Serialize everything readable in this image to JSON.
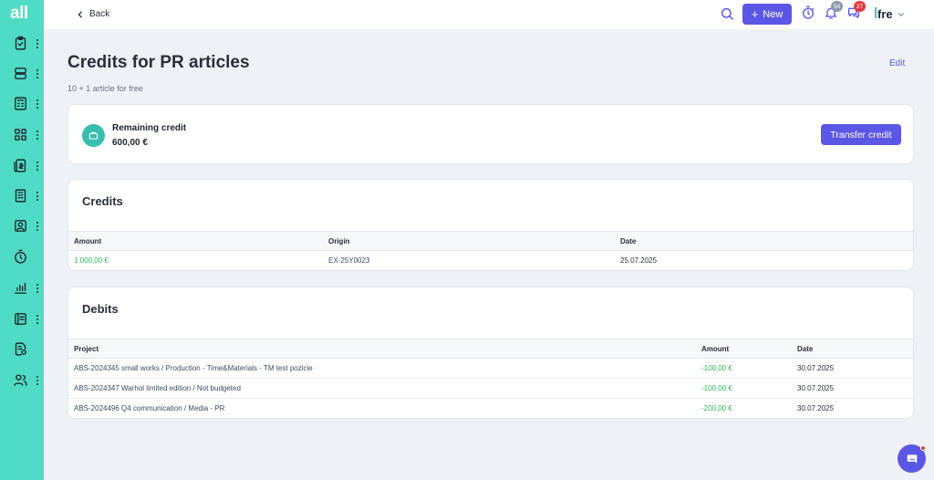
{
  "sidebar": {
    "logo": "all",
    "items": [
      {
        "icon": "clipboard-check-icon"
      },
      {
        "icon": "stack-icon"
      },
      {
        "icon": "calculator-icon"
      },
      {
        "icon": "grid-icon"
      },
      {
        "icon": "invoice-icon"
      },
      {
        "icon": "building-icon"
      },
      {
        "icon": "contact-icon"
      },
      {
        "icon": "stopwatch-icon"
      },
      {
        "icon": "bar-chart-icon"
      },
      {
        "icon": "book-icon"
      },
      {
        "icon": "document-settings-icon"
      },
      {
        "icon": "users-icon"
      }
    ]
  },
  "topbar": {
    "back_label": "Back",
    "new_label": "New",
    "notifications_count": "54",
    "messages_count": "27",
    "brand": "fre"
  },
  "page": {
    "title": "Credits for PR articles",
    "subtitle": "10 + 1 article for free",
    "edit_label": "Edit"
  },
  "remaining": {
    "label": "Remaining credit",
    "value": "600,00 €",
    "transfer_label": "Transfer credit"
  },
  "credits": {
    "title": "Credits",
    "headers": [
      "Amount",
      "Origin",
      "Date"
    ],
    "rows": [
      {
        "amount": "1 000,00 €",
        "origin": "EX-25Y0023",
        "date": "25.07.2025"
      }
    ]
  },
  "debits": {
    "title": "Debits",
    "headers": [
      "Project",
      "Amount",
      "Date"
    ],
    "rows": [
      {
        "project": "ABS-2024345 small works / Production - Time&Materials - TM test pozicie",
        "amount": "-100,00 €",
        "date": "30.07.2025"
      },
      {
        "project": "ABS-2024347 Warhol limited edition / Not budgeted",
        "amount": "-100,00 €",
        "date": "30.07.2025"
      },
      {
        "project": "ABS-2024496 Q4 communication / Media - PR",
        "amount": "-200,00 €",
        "date": "30.07.2025"
      }
    ]
  },
  "colors": {
    "accent": "#5b57e6",
    "sidebar": "#4fdcc4",
    "positive": "#2eb35c",
    "badge_red": "#e23d3d"
  }
}
